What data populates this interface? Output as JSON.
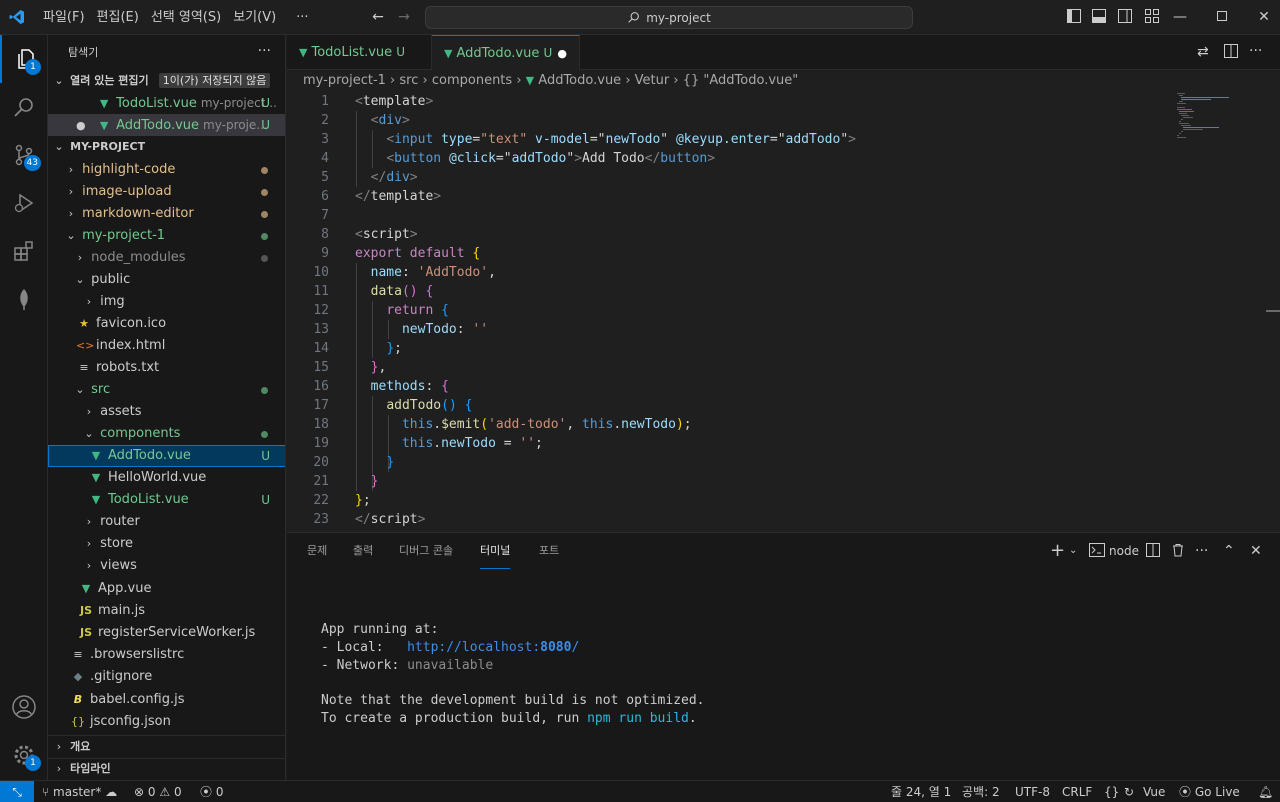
{
  "menu": [
    "파일(F)",
    "편집(E)",
    "선택 영역(S)",
    "보기(V)",
    "···"
  ],
  "search": {
    "text": "my-project"
  },
  "explorer": {
    "title": "탐색기",
    "open_editors": {
      "label": "열려 있는 편집기",
      "unsaved_badge": "1이(가) 저장되지 않음",
      "items": [
        {
          "name": "TodoList.vue",
          "desc": "my-project...",
          "status": "U"
        },
        {
          "name": "AddTodo.vue",
          "desc": "my-proje...",
          "status": "U"
        }
      ]
    },
    "project": "MY-PROJECT",
    "tree": [
      {
        "label": "highlight-code"
      },
      {
        "label": "image-upload"
      },
      {
        "label": "markdown-editor"
      },
      {
        "label": "my-project-1"
      },
      {
        "label": "node_modules"
      },
      {
        "label": "public"
      },
      {
        "label": "img"
      },
      {
        "label": "favicon.ico"
      },
      {
        "label": "index.html"
      },
      {
        "label": "robots.txt"
      },
      {
        "label": "src"
      },
      {
        "label": "assets"
      },
      {
        "label": "components"
      },
      {
        "label": "AddTodo.vue",
        "status": "U"
      },
      {
        "label": "HelloWorld.vue"
      },
      {
        "label": "TodoList.vue",
        "status": "U"
      },
      {
        "label": "router"
      },
      {
        "label": "store"
      },
      {
        "label": "views"
      },
      {
        "label": "App.vue"
      },
      {
        "label": "main.js"
      },
      {
        "label": "registerServiceWorker.js"
      },
      {
        "label": ".browserslistrc"
      },
      {
        "label": ".gitignore"
      },
      {
        "label": "babel.config.js"
      },
      {
        "label": "jsconfig.json"
      }
    ],
    "outline": "개요",
    "timeline": "타임라인"
  },
  "badges": {
    "scm": "43",
    "settings": "1",
    "explorer": "1"
  },
  "tabs": [
    {
      "label": "TodoList.vue",
      "status": "U"
    },
    {
      "label": "AddTodo.vue",
      "status": "U"
    }
  ],
  "breadcrumb": [
    "my-project-1",
    "src",
    "components",
    "AddTodo.vue",
    "Vetur",
    "{} \"AddTodo.vue\""
  ],
  "line_numbers": [
    "1",
    "2",
    "3",
    "4",
    "5",
    "6",
    "7",
    "8",
    "9",
    "10",
    "11",
    "12",
    "13",
    "14",
    "15",
    "16",
    "17",
    "18",
    "19",
    "20",
    "21",
    "22",
    "23"
  ],
  "code": {
    "l1": [
      "<",
      "template",
      ">"
    ],
    "l2": [
      "<",
      "div",
      ">"
    ],
    "l3": [
      "<",
      "input",
      "type",
      "=",
      "\"text\"",
      "v-model",
      "=",
      "\"",
      "newTodo",
      "\"",
      "@keyup.enter",
      "=",
      "\"",
      "addTodo",
      "\"",
      ">"
    ],
    "l4": [
      "<",
      "button",
      "@click",
      "=",
      "\"",
      "addTodo",
      "\"",
      ">",
      "Add Todo",
      "</",
      "button",
      ">"
    ],
    "l5": [
      "</",
      "div",
      ">"
    ],
    "l7": [
      "</",
      "template",
      ">"
    ],
    "l8": [
      "<",
      "script",
      ">"
    ],
    "l9": [
      "export",
      "default",
      "{"
    ],
    "l10": [
      "name",
      ":",
      "'AddTodo'",
      ","
    ],
    "l11": [
      "data",
      "(",
      ")",
      "{"
    ],
    "l12": [
      "return",
      "{"
    ],
    "l13": [
      "newTodo",
      ":",
      "''"
    ],
    "l14": [
      "}",
      ";"
    ],
    "l15": [
      "}",
      ","
    ],
    "l16": [
      "methods",
      ":",
      "{"
    ],
    "l17": [
      "addTodo",
      "(",
      ")",
      "{"
    ],
    "l18": [
      "this",
      ".",
      "$emit",
      "(",
      "'add-todo'",
      ",",
      "this",
      ".",
      "newTodo",
      ")",
      ";"
    ],
    "l19": [
      "this",
      ".",
      "newTodo",
      "=",
      "''",
      ";"
    ],
    "l20": [
      "}"
    ],
    "l21": [
      "}"
    ],
    "l22": [
      "}",
      ";"
    ],
    "l23": [
      "</",
      "script",
      ">"
    ]
  },
  "panel": {
    "tabs": [
      "문제",
      "출력",
      "디버그 콘솔",
      "터미널",
      "포트"
    ],
    "terminal_name": "node",
    "lines": {
      "running": "App running at:",
      "local_label": "- Local:   ",
      "local_url_host": "http://localhost:",
      "local_url_port": "8080",
      "local_url_end": "/",
      "network_label": "- Network: ",
      "network_value": "unavailable",
      "note": "Note that the development build is not optimized.",
      "build_prefix": "To create a production build, run ",
      "build_cmd": "npm run build",
      "build_end": "."
    }
  },
  "status": {
    "branch": "master*",
    "errors": "0",
    "warnings": "0",
    "ports": "0",
    "cursor": "줄 24, 열 1",
    "spaces": "공백: 2",
    "encoding": "UTF-8",
    "eol": "CRLF",
    "language": "Vue",
    "golive": "Go Live"
  },
  "colors": {
    "accent": "#0078d4",
    "git_untracked": "#73c991",
    "git_modified": "#e2c08d"
  }
}
